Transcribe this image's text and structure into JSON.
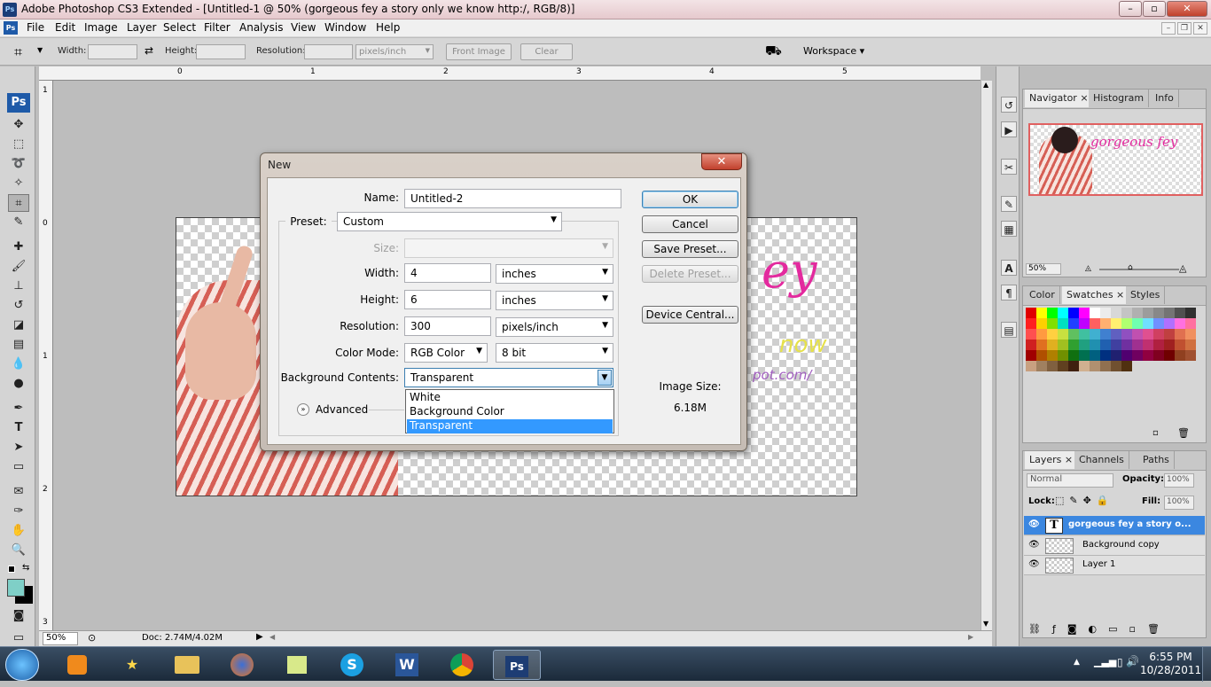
{
  "window": {
    "title": "Adobe Photoshop CS3 Extended - [Untitled-1 @ 50% (gorgeous fey a story only we know                    http:/, RGB/8)]",
    "minimize": "–",
    "maximize": "▫",
    "close": "✕"
  },
  "menubar": {
    "app_icon": "Ps",
    "items": [
      "File",
      "Edit",
      "Image",
      "Layer",
      "Select",
      "Filter",
      "Analysis",
      "View",
      "Window",
      "Help"
    ]
  },
  "options_bar": {
    "width_label": "Width:",
    "height_label": "Height:",
    "resolution_label": "Resolution:",
    "units_value": "pixels/inch",
    "front_image": "Front Image",
    "clear": "Clear",
    "workspace": "Workspace ▾"
  },
  "ruler": {
    "h_ticks": [
      "0",
      "1",
      "2",
      "3",
      "4",
      "5"
    ],
    "v_ticks": [
      "1",
      "0",
      "1",
      "2",
      "3"
    ]
  },
  "tools": {
    "ps_logo": "Ps"
  },
  "canvas": {
    "text_line1": "ey",
    "text_line2": "now",
    "text_line3": "pot.com/"
  },
  "status": {
    "zoom": "50%",
    "doc": "Doc: 2.74M/4.02M"
  },
  "navigator_panel": {
    "tabs": [
      "Navigator",
      "Histogram",
      "Info"
    ],
    "zoom": "50%",
    "thumb_text": "gorgeous fey"
  },
  "color_panel": {
    "tabs": [
      "Color",
      "Swatches",
      "Styles"
    ]
  },
  "layers_panel": {
    "tabs": [
      "Layers",
      "Channels",
      "Paths"
    ],
    "blend_mode": "Normal",
    "opacity_label": "Opacity:",
    "opacity_value": "100%",
    "lock_label": "Lock:",
    "fill_label": "Fill:",
    "fill_value": "100%",
    "layers": [
      {
        "name": "gorgeous fey a story o...",
        "selected": true,
        "type": "text"
      },
      {
        "name": "Background copy",
        "selected": false,
        "type": "image"
      },
      {
        "name": "Layer 1",
        "selected": false,
        "type": "image"
      }
    ]
  },
  "dialog": {
    "title": "New",
    "name_label": "Name:",
    "name_value": "Untitled-2",
    "preset_label": "Preset:",
    "preset_value": "Custom",
    "size_label": "Size:",
    "width_label": "Width:",
    "width_value": "4",
    "width_unit": "inches",
    "height_label": "Height:",
    "height_value": "6",
    "height_unit": "inches",
    "resolution_label": "Resolution:",
    "resolution_value": "300",
    "resolution_unit": "pixels/inch",
    "color_mode_label": "Color Mode:",
    "color_mode_value": "RGB Color",
    "bit_depth": "8 bit",
    "bg_label": "Background Contents:",
    "bg_value": "Transparent",
    "bg_options": [
      "White",
      "Background Color",
      "Transparent"
    ],
    "advanced": "Advanced",
    "ok": "OK",
    "cancel": "Cancel",
    "save_preset": "Save Preset...",
    "delete_preset": "Delete Preset...",
    "device_central": "Device Central...",
    "image_size_label": "Image Size:",
    "image_size_value": "6.18M"
  },
  "taskbar": {
    "time": "6:55 PM",
    "date": "10/28/2011",
    "ps_label": "Ps"
  },
  "colors": {
    "accent": "#3399ff",
    "layer_selected": "#3b87e0",
    "taskbar": "#1b2a3a"
  }
}
